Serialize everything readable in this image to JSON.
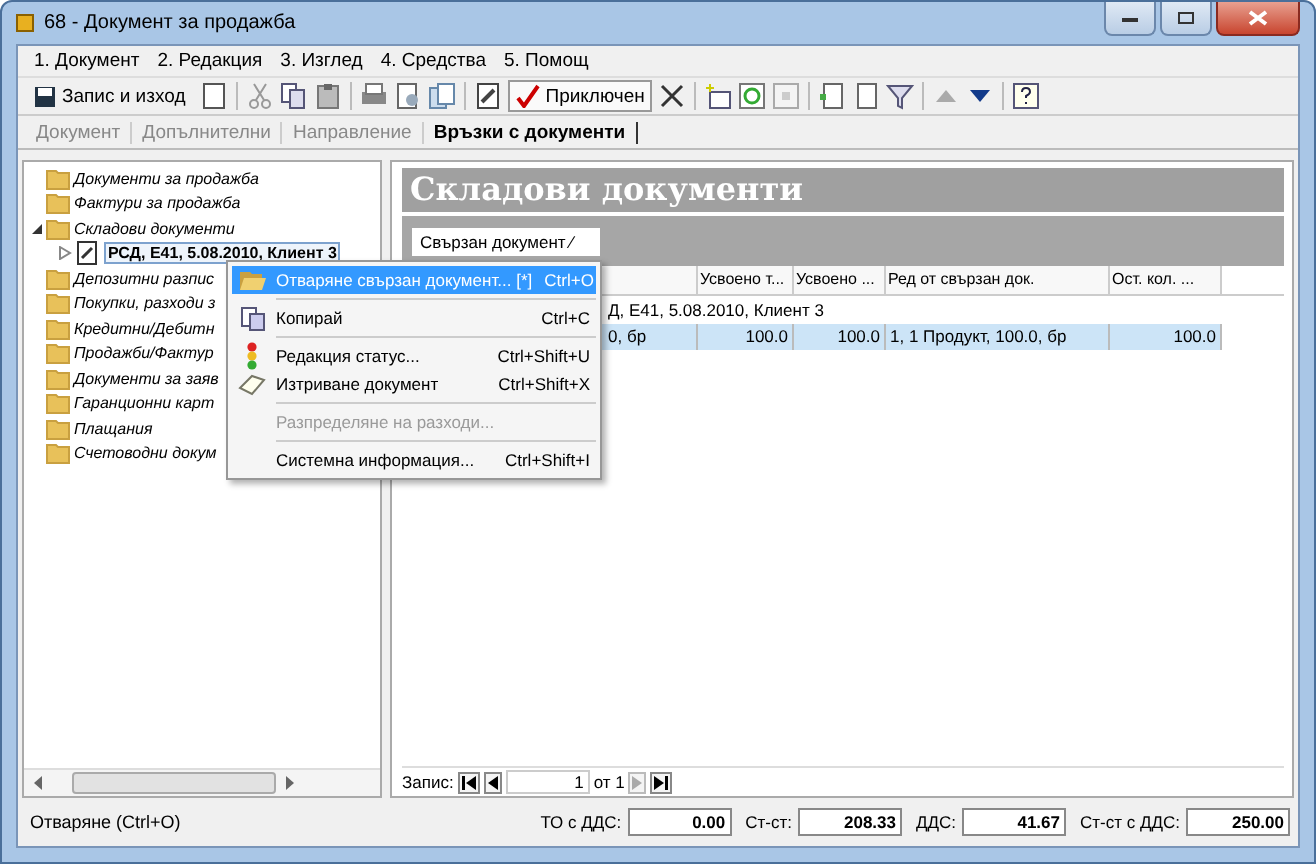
{
  "window": {
    "title": "68 - Документ за продажба"
  },
  "menu": [
    "1. Документ",
    "2. Редакция",
    "3. Изглед",
    "4. Средства",
    "5. Помощ"
  ],
  "toolbar": {
    "save_label": "Запис и изход",
    "status_label": "Приключен",
    "status_pressed": true
  },
  "tabs": [
    {
      "label": "Документ",
      "selected": false
    },
    {
      "label": "Допълнителни",
      "selected": false
    },
    {
      "label": "Направление",
      "selected": false
    },
    {
      "label": "Връзки с документи",
      "selected": true
    }
  ],
  "tree": [
    {
      "label": "Документи за продажба"
    },
    {
      "label": "Фактури за продажба"
    },
    {
      "label": "Складови документи",
      "expanded": true,
      "children": [
        {
          "label": "РСД, E41, 5.08.2010, Клиент 3",
          "expanded": false,
          "selected": true
        }
      ]
    },
    {
      "label": "Депозитни разпис"
    },
    {
      "label": "Покупки, разходи з"
    },
    {
      "label": "Кредитни/Дебитн"
    },
    {
      "label": "Продажби/Фактур"
    },
    {
      "label": "Документи за заяв"
    },
    {
      "label": "Гаранционни карт"
    },
    {
      "label": "Плащания"
    },
    {
      "label": "Счетоводни докум"
    }
  ],
  "panel": {
    "title": "Складови документи",
    "group_by": "Свързан документ ⁄"
  },
  "table": {
    "columns": [
      "",
      "Усвоено т...",
      "Усвоено ...",
      "Ред от свързан док.",
      "Ост. кол. ..."
    ],
    "group_row": "Д, E41, 5.08.2010, Клиент 3",
    "rows": [
      {
        "selected": true,
        "cells": [
          "0, бр",
          "100.0",
          "100.0",
          "1, 1 Продукт, 100.0, бр",
          "100.0"
        ]
      }
    ]
  },
  "context_menu": [
    {
      "kind": "open",
      "label": "Отваряне свързан документ... [*]",
      "shortcut": "Ctrl+O",
      "selected": true,
      "disabled": false
    },
    {
      "kind": "separator"
    },
    {
      "kind": "copy",
      "label": "Копирай",
      "shortcut": "Ctrl+C",
      "selected": false,
      "disabled": false
    },
    {
      "kind": "separator"
    },
    {
      "kind": "status",
      "label": "Редакция статус...",
      "shortcut": "Ctrl+Shift+U",
      "selected": false,
      "disabled": false
    },
    {
      "kind": "delete",
      "label": "Изтриване документ",
      "shortcut": "Ctrl+Shift+X",
      "selected": false,
      "disabled": false
    },
    {
      "kind": "separator"
    },
    {
      "kind": "item",
      "label": "Разпределяне на разходи...",
      "selected": false,
      "disabled": true
    },
    {
      "kind": "separator"
    },
    {
      "kind": "item",
      "label": "Системна информация...",
      "shortcut": "Ctrl+Shift+I",
      "selected": false,
      "disabled": false
    }
  ],
  "navigator": {
    "label": "Запис:",
    "value": "1",
    "of": "от 1"
  },
  "status_bar": {
    "message": "Отваряне (Ctrl+O)",
    "totals": [
      {
        "label": "ТО с ДДС:",
        "value": "0.00"
      },
      {
        "label": "Ст-ст:",
        "value": "208.33"
      },
      {
        "label": "ДДС:",
        "value": "41.67"
      },
      {
        "label": "Ст-ст с ДДС:",
        "value": "250.00"
      }
    ]
  }
}
